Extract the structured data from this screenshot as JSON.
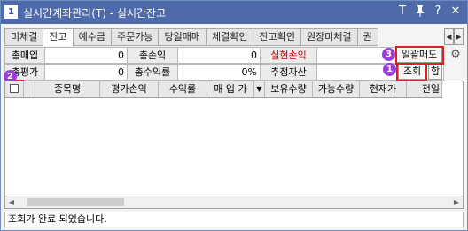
{
  "window": {
    "badge": "1",
    "title": "실시간계좌관리(T) - 실시간잔고",
    "icons": [
      "text-size-icon",
      "pin-icon",
      "help-icon",
      "close-icon"
    ]
  },
  "tabs": [
    {
      "label": "미체결",
      "active": false
    },
    {
      "label": "잔고",
      "active": true
    },
    {
      "label": "예수금",
      "active": false
    },
    {
      "label": "주문가능",
      "active": false
    },
    {
      "label": "당일매매",
      "active": false
    },
    {
      "label": "체결확인",
      "active": false
    },
    {
      "label": "잔고확인",
      "active": false
    },
    {
      "label": "원장미체결",
      "active": false
    },
    {
      "label": "권",
      "active": false
    }
  ],
  "tab_scroll": {
    "left": "◀",
    "right": "▶"
  },
  "summary": {
    "row1": [
      {
        "label": "총매입",
        "value": "0"
      },
      {
        "label": "총손익",
        "value": "0"
      },
      {
        "label": "실현손익",
        "value": ""
      }
    ],
    "row2": [
      {
        "label": "총평가",
        "value": "0"
      },
      {
        "label": "총수익률",
        "value": "0%"
      },
      {
        "label": "추정자산",
        "value": ""
      }
    ],
    "bulk_sell_button": "일괄매도",
    "query_button": "조회",
    "sum_button": "합",
    "settings_icon": "gear-icon"
  },
  "callouts": {
    "badge1": "1",
    "badge2": "2",
    "badge3": "3",
    "color": "#e02020",
    "badge_color": "#9a3fd6"
  },
  "grid": {
    "columns": [
      "종목명",
      "평가손익",
      "수익률",
      "매 입 가",
      "보유수량",
      "가능수량",
      "현재가",
      "전일"
    ],
    "sort_arrow": "▼"
  },
  "status": {
    "message": "조회가 완료 되었습니다."
  }
}
